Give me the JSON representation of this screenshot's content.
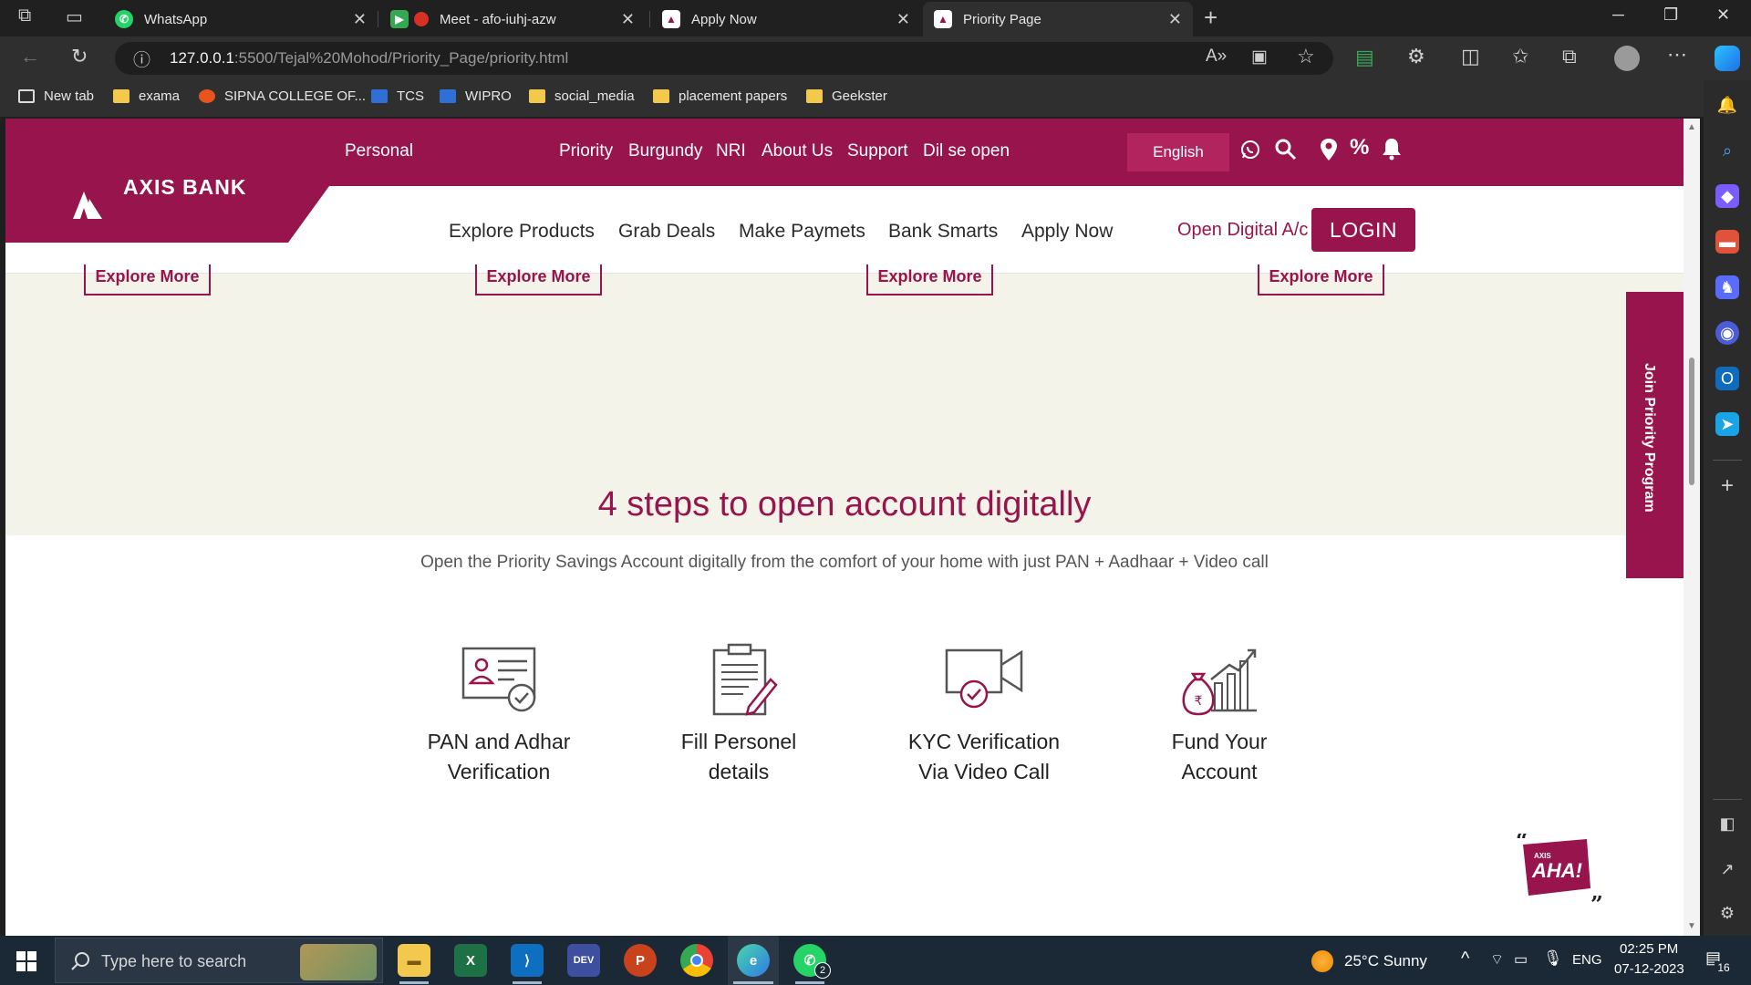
{
  "browser": {
    "tabs": [
      {
        "label": "WhatsApp",
        "favicon": "whatsapp-icon"
      },
      {
        "label": "Meet - afo-iuhj-azw",
        "favicon": "meet-icon"
      },
      {
        "label": "Apply Now",
        "favicon": "axis-icon"
      },
      {
        "label": "Priority Page",
        "favicon": "axis-icon"
      }
    ],
    "url_host": "127.0.0.1",
    "url_rest": ":5500/Tejal%20Mohod/Priority_Page/priority.html",
    "bookmarks": [
      "New tab",
      "exama",
      "SIPNA COLLEGE OF...",
      "TCS",
      "WIPRO",
      "social_media",
      "placement papers",
      "Geekster"
    ]
  },
  "page": {
    "top_nav": {
      "personal": "Personal",
      "links": [
        "Priority",
        "Burgundy",
        "NRI",
        "About Us",
        "Support",
        "Dil se open"
      ],
      "language": "English"
    },
    "logo_text": "AXIS BANK",
    "main_nav": {
      "links": [
        "Explore Products",
        "Grab Deals",
        "Make Paymets",
        "Bank Smarts",
        "Apply Now"
      ],
      "open_digital": "Open Digital A/c",
      "login": "LOGIN"
    },
    "explore_label": "Explore More",
    "join_priority": "Join Priority Program",
    "steps": {
      "title": "4 steps to open account digitally",
      "subtitle": "Open the Priority Savings Account digitally from the comfort of your home with just PAN + Aadhaar + Video call",
      "items": [
        {
          "line1": "PAN and Adhar",
          "line2": "Verification"
        },
        {
          "line1": "Fill Personel",
          "line2": "details"
        },
        {
          "line1": "KYC Verification",
          "line2": "Via Video Call"
        },
        {
          "line1": "Fund Your",
          "line2": "Account"
        }
      ]
    },
    "aha": {
      "small": "AXIS",
      "big": "AHA!"
    },
    "brand_color": "#97144d"
  },
  "taskbar": {
    "search_placeholder": "Type here to search",
    "weather": "25°C  Sunny",
    "language": "ENG",
    "time": "02:25 PM",
    "date": "07-12-2023",
    "notification_count": "16",
    "whatsapp_badge": "2"
  }
}
